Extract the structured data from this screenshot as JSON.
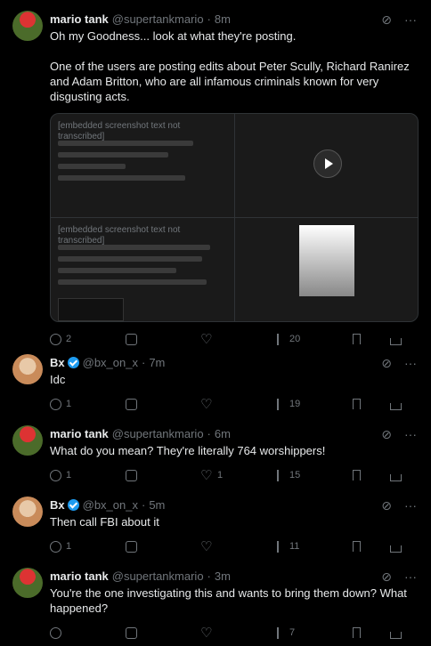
{
  "posts": [
    {
      "name": "mario tank",
      "handle": "@supertankmario",
      "time": "8m",
      "text": "Oh my Goodness... look at what they're posting.\n\nOne of the users are posting edits about Peter Scully, Richard Ranirez and Adam Britton, who are all infamous criminals known for very disgusting acts.",
      "replies": "2",
      "reposts": "",
      "likes": "",
      "views": "20"
    },
    {
      "name": "Bx",
      "handle": "@bx_on_x",
      "time": "7m",
      "text": "Idc",
      "replies": "1",
      "reposts": "",
      "likes": "",
      "views": "19"
    },
    {
      "name": "mario tank",
      "handle": "@supertankmario",
      "time": "6m",
      "text": "What do you mean? They're literally 764 worshippers!",
      "replies": "1",
      "reposts": "",
      "likes": "1",
      "views": "15"
    },
    {
      "name": "Bx",
      "handle": "@bx_on_x",
      "time": "5m",
      "text": "Then call FBI about it",
      "replies": "1",
      "reposts": "",
      "likes": "",
      "views": "11"
    },
    {
      "name": "mario tank",
      "handle": "@supertankmario",
      "time": "3m",
      "text": "You're the one investigating this and wants to bring them down? What happened?",
      "replies": "",
      "reposts": "",
      "likes": "",
      "views": "7"
    }
  ],
  "media": {
    "redaction_note": "[embedded screenshot text not transcribed]"
  },
  "icons": {
    "reply": "reply-icon",
    "repost": "repost-icon",
    "like": "like-icon",
    "views": "views-icon",
    "bookmark": "bookmark-icon",
    "share": "share-icon",
    "grok": "grok-icon",
    "more": "more-icon"
  },
  "colors": {
    "background": "#000000",
    "text": "#e7e9ea",
    "muted": "#71767b",
    "verified": "#1d9bf0",
    "border": "#2f3336"
  }
}
